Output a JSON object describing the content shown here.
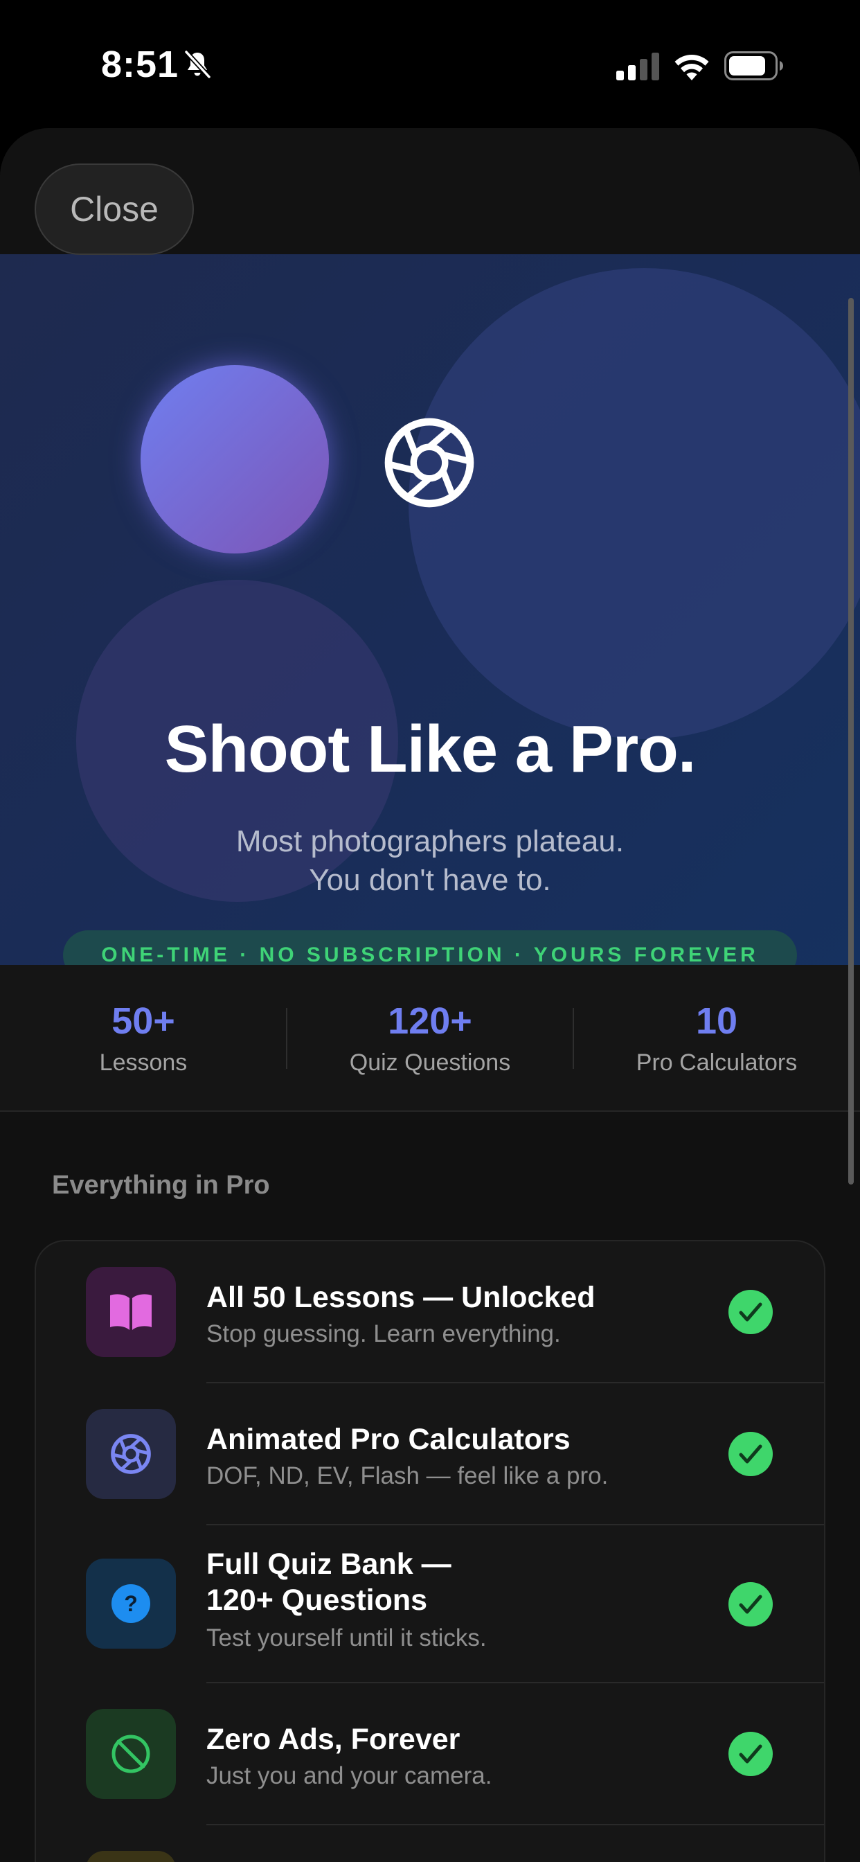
{
  "status_bar": {
    "time": "8:51",
    "icons": [
      "bell-slash-icon",
      "signal-icon",
      "wifi-icon",
      "battery-icon"
    ]
  },
  "sheet": {
    "close_label": "Close"
  },
  "hero": {
    "title": "Shoot Like a Pro.",
    "subtitle_line1": "Most photographers plateau.",
    "subtitle_line2": "You don't have to.",
    "pill": "ONE-TIME · NO SUBSCRIPTION · YOURS FOREVER",
    "icon": "aperture-icon"
  },
  "stats": [
    {
      "value": "50+",
      "label": "Lessons"
    },
    {
      "value": "120+",
      "label": "Quiz Questions"
    },
    {
      "value": "10",
      "label": "Pro Calculators"
    }
  ],
  "features": {
    "section_title": "Everything in Pro",
    "items": [
      {
        "title": "All 50 Lessons — Unlocked",
        "desc": "Stop guessing. Learn everything.",
        "icon": "book-icon",
        "icon_bg": "#3a1a3e",
        "icon_color": "#e26ae0"
      },
      {
        "title": "Animated Pro Calculators",
        "desc": "DOF, ND, EV, Flash — feel like a pro.",
        "icon": "aperture-icon",
        "icon_bg": "#262a42",
        "icon_color": "#7a86f2"
      },
      {
        "title_line1": "Full Quiz Bank —",
        "title_line2": "120+ Questions",
        "desc": "Test yourself until it sticks.",
        "icon": "question-circle-icon",
        "icon_bg": "#13304a",
        "icon_color": "#1d8df0"
      },
      {
        "title": "Zero Ads, Forever",
        "desc": "Just you and your camera.",
        "icon": "no-ads-icon",
        "icon_bg": "#1b3a22",
        "icon_color": "#33c463"
      }
    ],
    "check_color": "#3fd66b"
  },
  "colors": {
    "accent": "#6f7ef0",
    "success": "#3fd66b",
    "background": "#111111"
  }
}
